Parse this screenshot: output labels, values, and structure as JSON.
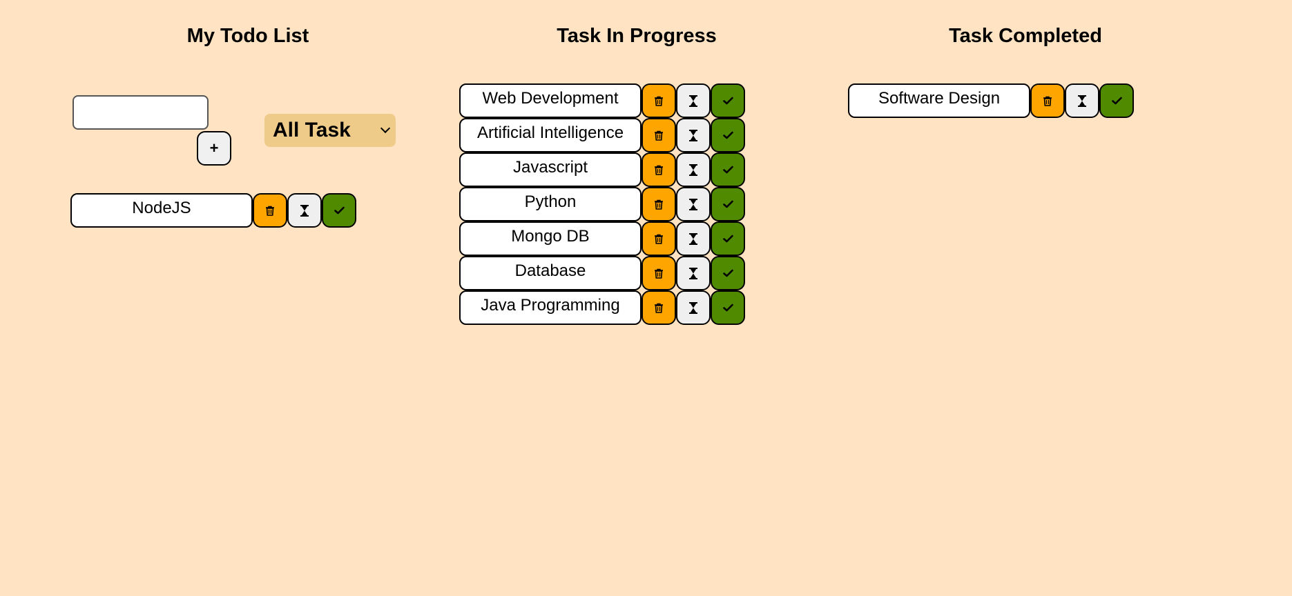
{
  "columns": {
    "todo": {
      "title": "My Todo List"
    },
    "in_progress": {
      "title": "Task In Progress"
    },
    "completed": {
      "title": "Task Completed"
    }
  },
  "add_form": {
    "input_value": "",
    "input_placeholder": "",
    "add_label": "+"
  },
  "filter": {
    "selected": "All Task"
  },
  "icons": {
    "delete": "trash-icon",
    "in_progress": "hourglass-icon",
    "complete": "check-icon"
  },
  "colors": {
    "background": "#ffe3c2",
    "delete_button": "#ffa500",
    "progress_button": "#efefef",
    "complete_button": "#4f8a00",
    "filter_background": "#efcb8a"
  },
  "todo_tasks": [
    "NodeJS"
  ],
  "in_progress_tasks": [
    "Web Development",
    "Artificial Intelligence",
    "Javascript",
    "Python",
    "Mongo DB",
    "Database",
    "Java Programming"
  ],
  "completed_tasks": [
    "Software Design"
  ]
}
